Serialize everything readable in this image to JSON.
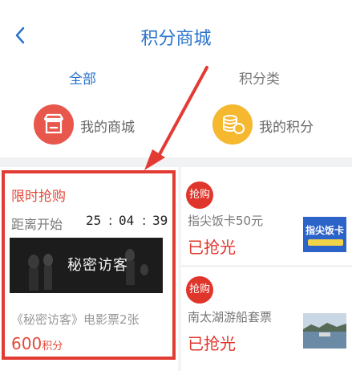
{
  "header": {
    "title": "积分商城"
  },
  "tabs": [
    {
      "label": "全部",
      "active": true
    },
    {
      "label": "积分类",
      "active": false
    }
  ],
  "shortcuts": [
    {
      "label": "我的商城",
      "icon": "shop-icon",
      "color": "#e8574c"
    },
    {
      "label": "我的积分",
      "icon": "coins-icon",
      "color": "#f5b82e"
    }
  ],
  "flash_sale": {
    "title": "限时抢购",
    "countdown_label": "距离开始",
    "countdown": {
      "hours": "25",
      "minutes": "04",
      "seconds": "39"
    },
    "poster_title": "秘密访客",
    "product_name": "《秘密访客》电影票2张",
    "price": "600",
    "price_unit": "积分"
  },
  "items": [
    {
      "badge": "抢购",
      "name": "指尖饭卡50元",
      "status": "已抢光",
      "thumb_text": "指尖饭卡"
    },
    {
      "badge": "抢购",
      "name": "南太湖游船套票",
      "status": "已抢光"
    }
  ],
  "colors": {
    "accent": "#2a73cc",
    "sale_red": "#e0352b",
    "highlight_frame": "#e23b33"
  }
}
